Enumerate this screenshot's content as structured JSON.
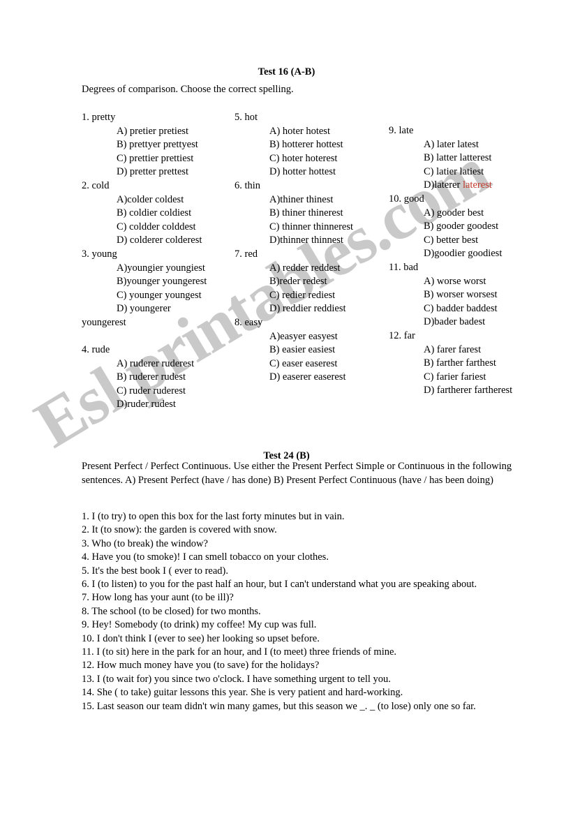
{
  "watermark": {
    "text": "Esl printables.com"
  },
  "colors": {
    "highlight_red": "#c0392b",
    "text": "#000000",
    "watermark": "#c9c9c9"
  },
  "test16": {
    "title": "Test 16 (A-B)",
    "instructions": "Degrees of comparison. Choose the correct spelling.",
    "column1": [
      {
        "stem": "1. pretty",
        "options": [
          "A) pretier pretiest",
          "B) prettyer prettyest",
          "C) prettier prettiest",
          "D) pretter prettest"
        ]
      },
      {
        "stem": "2. cold",
        "options": [
          "A)colder coldest",
          "B) coldier coldiest",
          "C) coldder colddest",
          "D) colderer colderest"
        ]
      },
      {
        "stem": "3. young",
        "options": [
          "A)youngier youngiest",
          "B)younger youngerest",
          "C) younger youngest",
          "D) youngerer"
        ],
        "overflow": "youngerest"
      },
      {
        "stem": "4. rude",
        "options": [
          "A) ruderer ruderest",
          "B) ruderer rudest",
          "C) ruder ruderest",
          "D)ruder rudest"
        ]
      }
    ],
    "column2": [
      {
        "stem": "5. hot",
        "options": [
          "A) hoter hotest",
          "B) hotterer hottest",
          "C) hoter hoterest",
          "D) hotter hottest"
        ]
      },
      {
        "stem": "6. thin",
        "options": [
          "A)thiner thinest",
          "B) thiner thinerest",
          "C) thinner thinnerest",
          "D)thinner thinnest"
        ]
      },
      {
        "stem": "7. red",
        "options": [
          "A) redder reddest",
          "B)reder redest",
          "C) redier rediest",
          "D) reddier reddiest"
        ]
      },
      {
        "stem": "8. easy",
        "options": [
          "A)easyer easyest",
          "B) easier easiest",
          "C) easer easerest",
          "D) easerer easerest"
        ]
      }
    ],
    "column3": [
      {
        "stem": "9. late",
        "options": [
          "A) later latest",
          "B) latter latterest",
          "C) latier latiest"
        ],
        "last_option_prefix": "D)laterer ",
        "last_option_red": "laterest"
      },
      {
        "stem": "10. good",
        "options": [
          "A) gooder best",
          "B) gooder goodest",
          "C) better best",
          "D)goodier goodiest"
        ]
      },
      {
        "stem": "11. bad",
        "options": [
          "A) worse worst",
          "B) worser worsest",
          "C) badder baddest",
          "D)bader badest"
        ]
      },
      {
        "stem": "12. far",
        "options": [
          "A) farer farest",
          "B) farther farthest",
          "C) farier fariest",
          "D) fartherer fartherest"
        ]
      }
    ]
  },
  "test24": {
    "title": "Test 24 (B)",
    "instructions": "Present Perfect / Perfect Continuous. Use either the Present Perfect Simple or Continuous in the following sentences.  A) Present Perfect (have / has done)  B) Present Perfect Continuous (have / has been doing)",
    "sentences": [
      "1. I (to try) to open this box for the last forty minutes but in vain.",
      "2. It (to snow): the garden is covered with snow.",
      "3. Who (to break) the window?",
      "4. Have you (to smoke)! I can smell tobacco on your clothes.",
      "5. It's the best book I ( ever to read).",
      "6. I (to listen) to you for the past half an hour, but I can't understand what you are speaking about.",
      "7. How long has your aunt (to be ill)?",
      "8. The school (to be closed) for two months.",
      "9. Hey! Somebody (to drink) my coffee! My cup was full.",
      "10. I don't think I (ever to see) her looking so upset before.",
      "11. I (to sit) here in the park for an hour, and I (to meet) three friends of mine.",
      "12. How much money have you (to save) for the holidays?",
      "13. I (to wait for) you since two o'clock. I have something urgent to tell you.",
      "14. She ( to take) guitar lessons this year. She is very patient and hard-working.",
      "15. Last season our team didn't win many games, but this season we _. _ (to lose) only one so far."
    ]
  }
}
